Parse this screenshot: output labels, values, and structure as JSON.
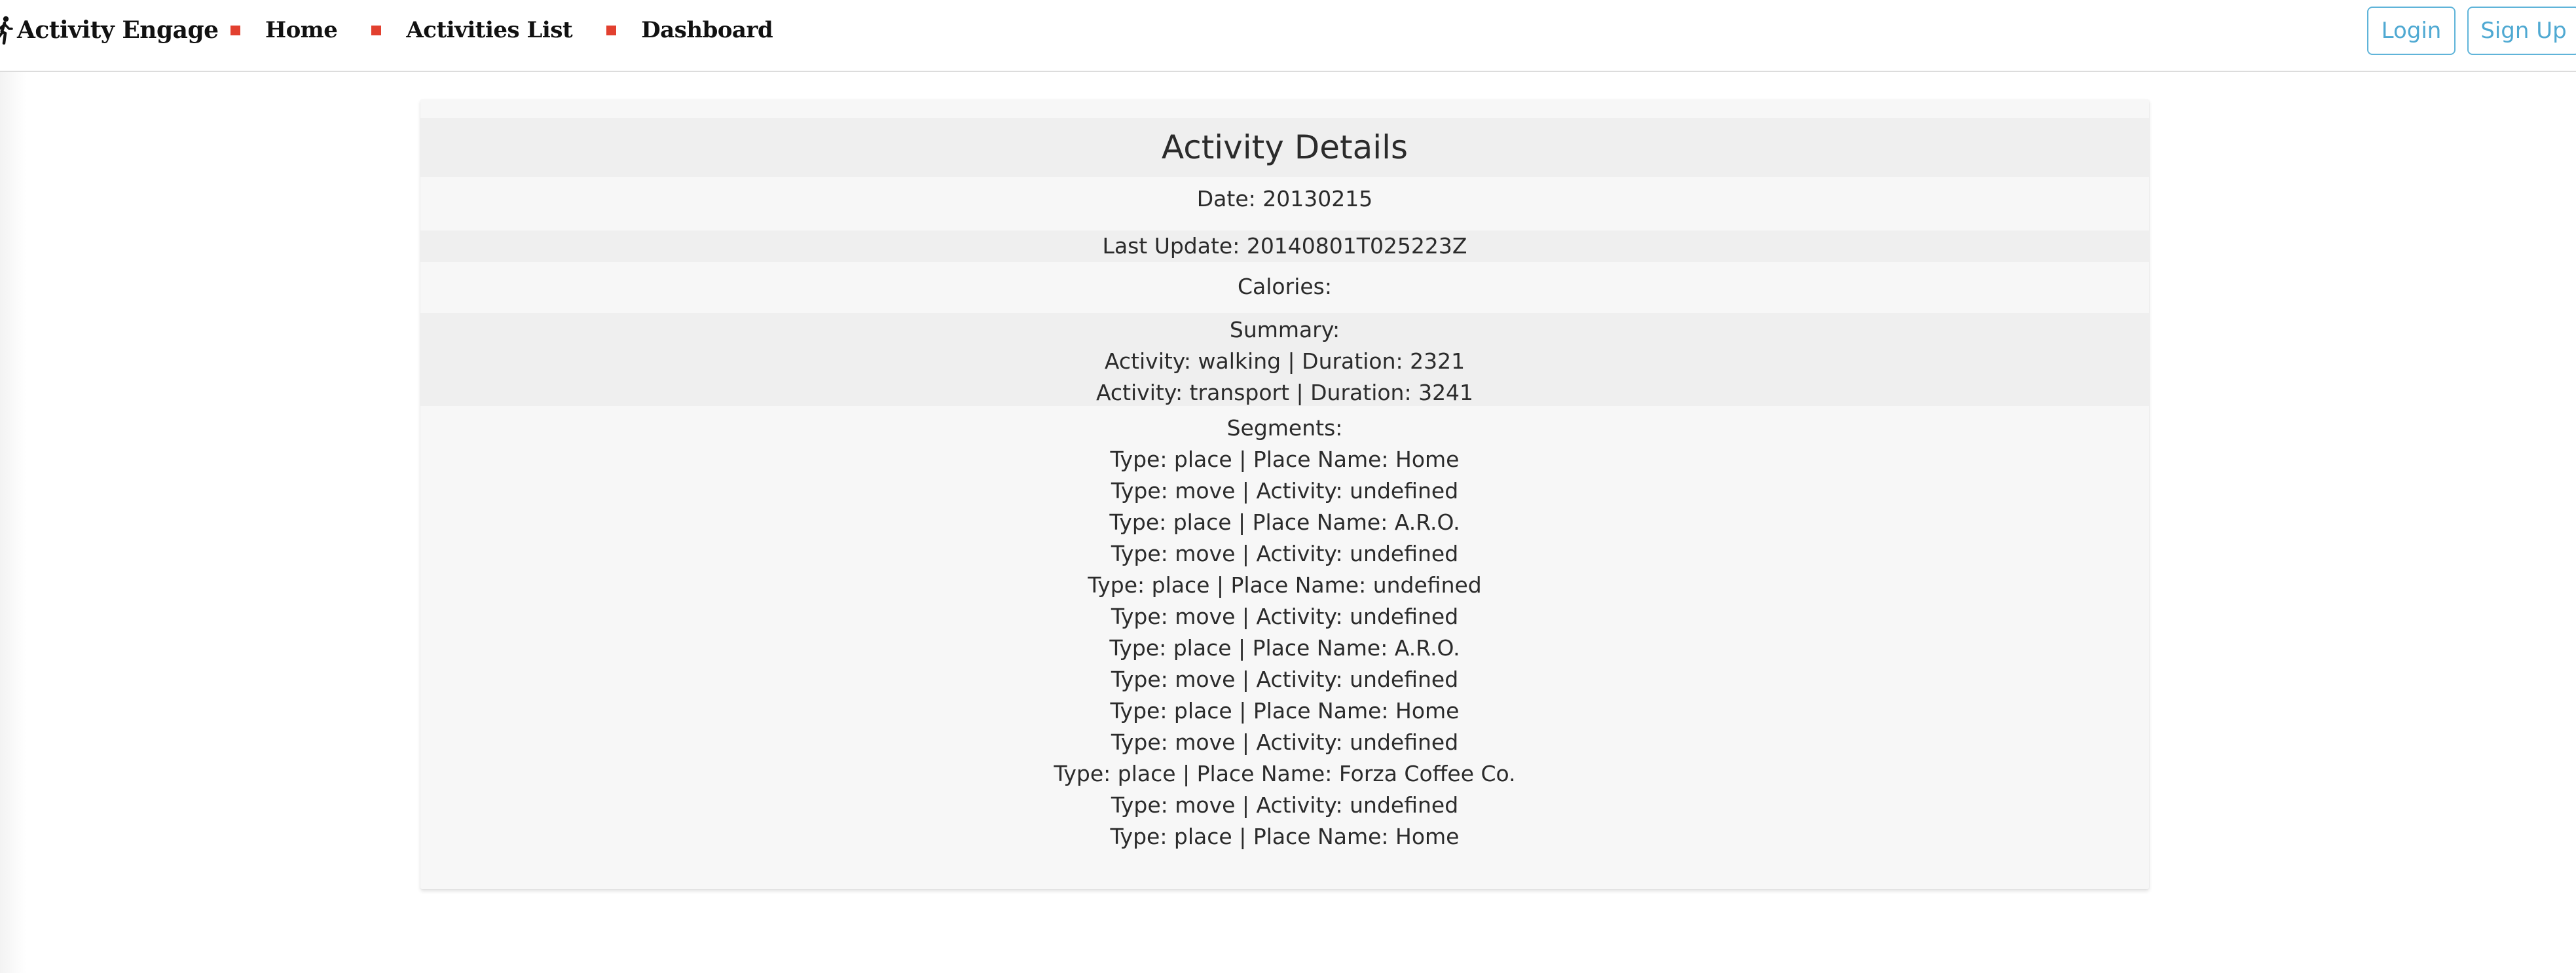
{
  "nav": {
    "brand": "Activity Engage",
    "links": [
      {
        "label": "Home"
      },
      {
        "label": "Activities List"
      },
      {
        "label": "Dashboard"
      }
    ],
    "login_label": "Login",
    "signup_label": "Sign Up"
  },
  "colors": {
    "accent": "#e2402f",
    "button_outline": "#5fb4d9"
  },
  "activity": {
    "title": "Activity Details",
    "date": "Date: 20130215",
    "last_update": "Last Update: 20140801T025223Z",
    "calories": "Calories:",
    "summary_label": "Summary:",
    "summary": [
      "Activity: walking | Duration: 2321",
      "Activity: transport | Duration: 3241"
    ],
    "segments_label": "Segments:",
    "segments": [
      "Type: place | Place Name: Home",
      "Type: move | Activity: undefined",
      "Type: place | Place Name: A.R.O.",
      "Type: move | Activity: undefined",
      "Type: place | Place Name: undefined",
      "Type: move | Activity: undefined",
      "Type: place | Place Name: A.R.O.",
      "Type: move | Activity: undefined",
      "Type: place | Place Name: Home",
      "Type: move | Activity: undefined",
      "Type: place | Place Name: Forza Coffee Co.",
      "Type: move | Activity: undefined",
      "Type: place | Place Name: Home"
    ]
  }
}
